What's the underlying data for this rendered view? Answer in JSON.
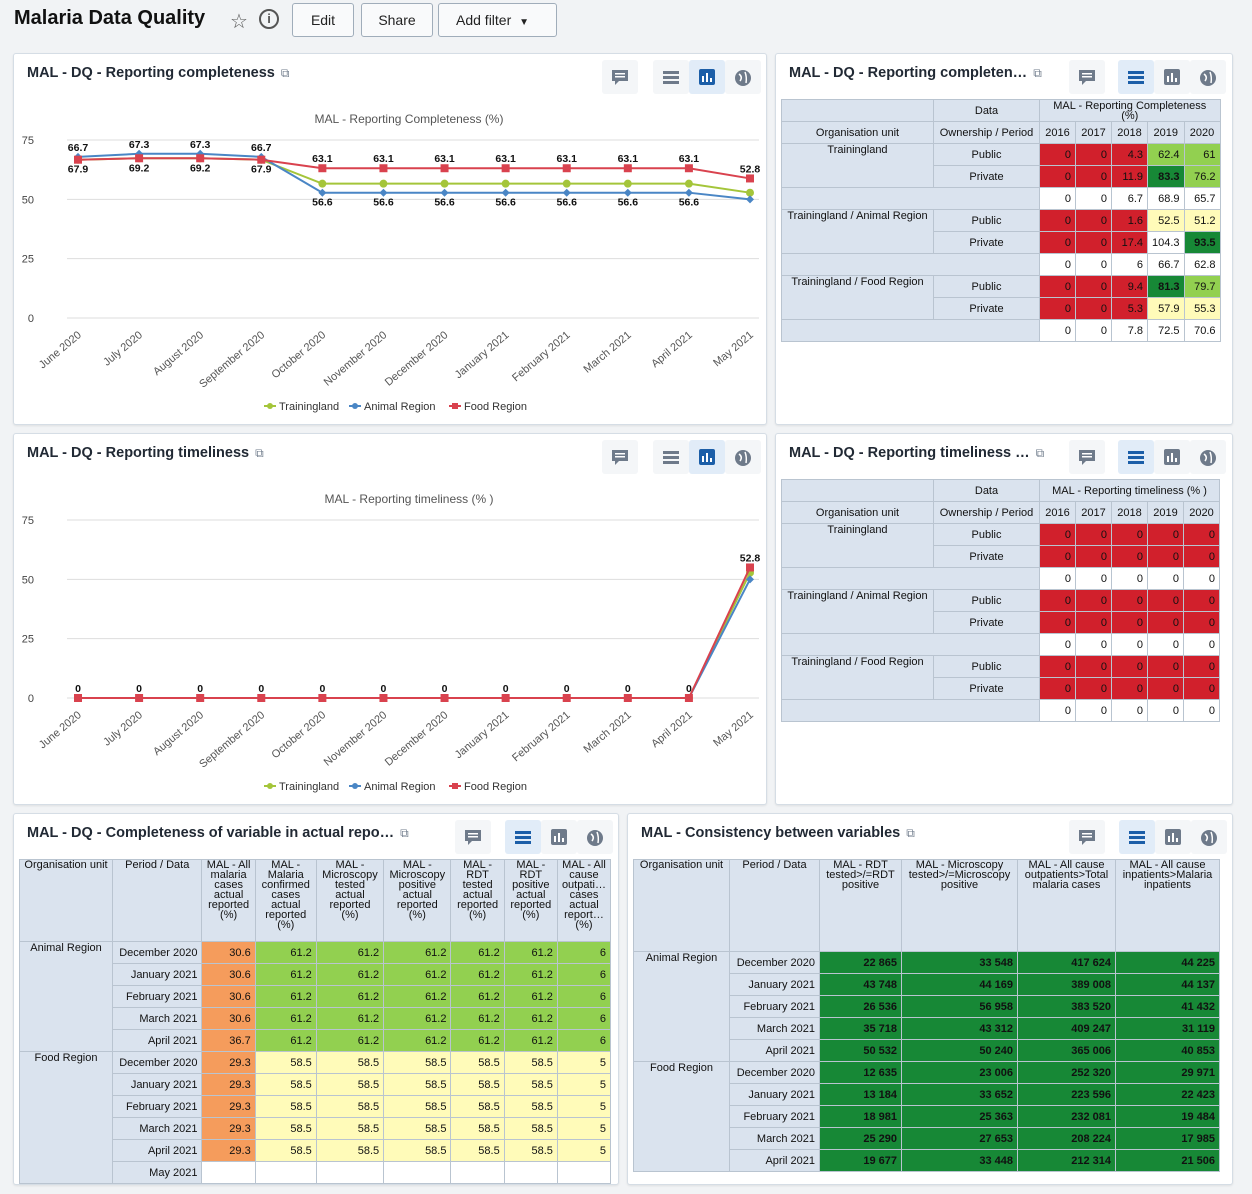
{
  "header": {
    "title": "Malaria Data Quality",
    "edit": "Edit",
    "share": "Share",
    "add_filter": "Add filter"
  },
  "icons": [
    "star-icon",
    "info-icon",
    "chevron-down-icon",
    "comment-icon",
    "table-icon",
    "chart-icon",
    "globe-icon",
    "external-link-icon"
  ],
  "cards": {
    "rep_completeness_chart": {
      "title": "MAL - DQ - Reporting completeness"
    },
    "rep_completeness_table": {
      "title": "MAL - DQ - Reporting completen…"
    },
    "rep_timeliness_chart": {
      "title": "MAL - DQ - Reporting timeliness"
    },
    "rep_timeliness_table": {
      "title": "MAL - DQ - Reporting timeliness …"
    },
    "var_completeness": {
      "title": "MAL - DQ - Completeness of variable in actual repo…"
    },
    "consistency": {
      "title": "MAL - Consistency between variables"
    }
  },
  "chart_data": [
    {
      "type": "line",
      "title": "MAL - Reporting Completeness (%)",
      "categories": [
        "June 2020",
        "July 2020",
        "August 2020",
        "September 2020",
        "October 2020",
        "November 2020",
        "December 2020",
        "January 2021",
        "February 2021",
        "March 2021",
        "April 2021",
        "May 2021"
      ],
      "yticks": [
        0,
        25,
        50,
        75
      ],
      "ylim": [
        0,
        75
      ],
      "legend_position": "bottom",
      "series": [
        {
          "name": "Trainingland",
          "color": "#a4c53a",
          "values": [
            66.7,
            67.3,
            67.3,
            66.7,
            56.6,
            56.6,
            56.6,
            56.6,
            56.6,
            56.6,
            56.6,
            52.8
          ]
        },
        {
          "name": "Animal Region",
          "color": "#4a86c5",
          "values": [
            67.9,
            69.2,
            69.2,
            67.9,
            52.8,
            52.8,
            52.8,
            52.8,
            52.8,
            52.8,
            52.8,
            50
          ]
        },
        {
          "name": "Food Region",
          "color": "#d9424e",
          "values": [
            66.7,
            67.3,
            67.3,
            66.7,
            63.1,
            63.1,
            63.1,
            63.1,
            63.1,
            63.1,
            63.1,
            58.8
          ]
        }
      ],
      "value_labels_top": [
        "66.7",
        "67.3",
        "67.3",
        "66.7",
        "63.1",
        "63.1",
        "63.1",
        "63.1",
        "63.1",
        "63.1",
        "63.1",
        "52.8"
      ],
      "value_labels_bottom": [
        "67.9",
        "69.2",
        "69.2",
        "67.9",
        "56.6",
        "56.6",
        "56.6",
        "56.6",
        "56.6",
        "56.6",
        "56.6",
        ""
      ]
    },
    {
      "type": "line",
      "title": "MAL - Reporting timeliness (% )",
      "categories": [
        "June 2020",
        "July 2020",
        "August 2020",
        "September 2020",
        "October 2020",
        "November 2020",
        "December 2020",
        "January 2021",
        "February 2021",
        "March 2021",
        "April 2021",
        "May 2021"
      ],
      "yticks": [
        0,
        25,
        50,
        75
      ],
      "ylim": [
        0,
        75
      ],
      "legend_position": "bottom",
      "series": [
        {
          "name": "Trainingland",
          "color": "#a4c53a",
          "values": [
            0,
            0,
            0,
            0,
            0,
            0,
            0,
            0,
            0,
            0,
            0,
            52.8
          ]
        },
        {
          "name": "Animal Region",
          "color": "#4a86c5",
          "values": [
            0,
            0,
            0,
            0,
            0,
            0,
            0,
            0,
            0,
            0,
            0,
            50
          ]
        },
        {
          "name": "Food Region",
          "color": "#d9424e",
          "values": [
            0,
            0,
            0,
            0,
            0,
            0,
            0,
            0,
            0,
            0,
            0,
            55
          ]
        }
      ],
      "value_labels_top": [
        "0",
        "0",
        "0",
        "0",
        "0",
        "0",
        "0",
        "0",
        "0",
        "0",
        "0",
        "52.8"
      ],
      "value_labels_bottom": [
        "",
        "",
        "",
        "",
        "",
        "",
        "",
        "",
        "",
        "",
        "",
        ""
      ]
    }
  ],
  "table_completeness": {
    "data_label": "Data",
    "metric": "MAL - Reporting Completeness (%)",
    "org_label": "Organisation unit",
    "own_label": "Ownership / Period",
    "years": [
      "2016",
      "2017",
      "2018",
      "2019",
      "2020"
    ],
    "rows": [
      {
        "org": "Trainingland",
        "own": "Public",
        "vals": [
          "0",
          "0",
          "4.3",
          "62.4",
          "61"
        ],
        "cls": [
          "red",
          "red",
          "red",
          "lgrn",
          "lgrn"
        ]
      },
      {
        "org": "",
        "own": "Private",
        "vals": [
          "0",
          "0",
          "11.9",
          "83.3",
          "76.2"
        ],
        "cls": [
          "red",
          "red",
          "red",
          "dgrn",
          "lgrn"
        ]
      },
      {
        "org": "",
        "own": "",
        "vals": [
          "0",
          "0",
          "6.7",
          "68.9",
          "65.7"
        ],
        "cls": [
          "num",
          "num",
          "num",
          "num",
          "num"
        ]
      },
      {
        "org": "Trainingland / Animal Region",
        "own": "Public",
        "vals": [
          "0",
          "0",
          "1.6",
          "52.5",
          "51.2"
        ],
        "cls": [
          "red",
          "red",
          "red",
          "yel",
          "yel"
        ]
      },
      {
        "org": "",
        "own": "Private",
        "vals": [
          "0",
          "0",
          "17.4",
          "104.3",
          "93.5"
        ],
        "cls": [
          "red",
          "red",
          "red",
          "num",
          "dgrn"
        ]
      },
      {
        "org": "",
        "own": "",
        "vals": [
          "0",
          "0",
          "6",
          "66.7",
          "62.8"
        ],
        "cls": [
          "num",
          "num",
          "num",
          "num",
          "num"
        ]
      },
      {
        "org": "Trainingland / Food Region",
        "own": "Public",
        "vals": [
          "0",
          "0",
          "9.4",
          "81.3",
          "79.7"
        ],
        "cls": [
          "red",
          "red",
          "red",
          "dgrn",
          "lgrn"
        ]
      },
      {
        "org": "",
        "own": "Private",
        "vals": [
          "0",
          "0",
          "5.3",
          "57.9",
          "55.3"
        ],
        "cls": [
          "red",
          "red",
          "red",
          "yel",
          "yel"
        ]
      },
      {
        "org": "",
        "own": "",
        "vals": [
          "0",
          "0",
          "7.8",
          "72.5",
          "70.6"
        ],
        "cls": [
          "num",
          "num",
          "num",
          "num",
          "num"
        ]
      }
    ]
  },
  "table_timeliness": {
    "data_label": "Data",
    "metric": "MAL - Reporting timeliness (% )",
    "org_label": "Organisation unit",
    "own_label": "Ownership / Period",
    "years": [
      "2016",
      "2017",
      "2018",
      "2019",
      "2020"
    ],
    "rows": [
      {
        "org": "Trainingland",
        "own": "Public",
        "vals": [
          "0",
          "0",
          "0",
          "0",
          "0"
        ],
        "cls": [
          "red",
          "red",
          "red",
          "red",
          "red"
        ]
      },
      {
        "org": "",
        "own": "Private",
        "vals": [
          "0",
          "0",
          "0",
          "0",
          "0"
        ],
        "cls": [
          "red",
          "red",
          "red",
          "red",
          "red"
        ]
      },
      {
        "org": "",
        "own": "",
        "vals": [
          "0",
          "0",
          "0",
          "0",
          "0"
        ],
        "cls": [
          "num",
          "num",
          "num",
          "num",
          "num"
        ]
      },
      {
        "org": "Trainingland / Animal Region",
        "own": "Public",
        "vals": [
          "0",
          "0",
          "0",
          "0",
          "0"
        ],
        "cls": [
          "red",
          "red",
          "red",
          "red",
          "red"
        ]
      },
      {
        "org": "",
        "own": "Private",
        "vals": [
          "0",
          "0",
          "0",
          "0",
          "0"
        ],
        "cls": [
          "red",
          "red",
          "red",
          "red",
          "red"
        ]
      },
      {
        "org": "",
        "own": "",
        "vals": [
          "0",
          "0",
          "0",
          "0",
          "0"
        ],
        "cls": [
          "num",
          "num",
          "num",
          "num",
          "num"
        ]
      },
      {
        "org": "Trainingland / Food Region",
        "own": "Public",
        "vals": [
          "0",
          "0",
          "0",
          "0",
          "0"
        ],
        "cls": [
          "red",
          "red",
          "red",
          "red",
          "red"
        ]
      },
      {
        "org": "",
        "own": "Private",
        "vals": [
          "0",
          "0",
          "0",
          "0",
          "0"
        ],
        "cls": [
          "red",
          "red",
          "red",
          "red",
          "red"
        ]
      },
      {
        "org": "",
        "own": "",
        "vals": [
          "0",
          "0",
          "0",
          "0",
          "0"
        ],
        "cls": [
          "num",
          "num",
          "num",
          "num",
          "num"
        ]
      }
    ]
  },
  "table_var": {
    "headers": [
      "Organisation unit",
      "Period / Data",
      "MAL - All malaria cases actual reported (%)",
      "MAL - Malaria confirmed cases actual reported (%)",
      "MAL - Microscopy tested actual reported (%)",
      "MAL - Microscopy positive actual reported (%)",
      "MAL - RDT tested actual reported (%)",
      "MAL - RDT positive actual reported (%)",
      "MAL - All cause outpati… cases actual report… (%)"
    ],
    "groups": [
      {
        "org": "Animal Region",
        "rows": [
          {
            "p": "December 2020",
            "v": [
              "30.6",
              "61.2",
              "61.2",
              "61.2",
              "61.2",
              "61.2",
              "6"
            ]
          },
          {
            "p": "January 2021",
            "v": [
              "30.6",
              "61.2",
              "61.2",
              "61.2",
              "61.2",
              "61.2",
              "6"
            ]
          },
          {
            "p": "February 2021",
            "v": [
              "30.6",
              "61.2",
              "61.2",
              "61.2",
              "61.2",
              "61.2",
              "6"
            ]
          },
          {
            "p": "March 2021",
            "v": [
              "30.6",
              "61.2",
              "61.2",
              "61.2",
              "61.2",
              "61.2",
              "6"
            ]
          },
          {
            "p": "April 2021",
            "v": [
              "36.7",
              "61.2",
              "61.2",
              "61.2",
              "61.2",
              "61.2",
              "6"
            ]
          }
        ]
      },
      {
        "org": "Food Region",
        "rows": [
          {
            "p": "December 2020",
            "v": [
              "29.3",
              "58.5",
              "58.5",
              "58.5",
              "58.5",
              "58.5",
              "5"
            ]
          },
          {
            "p": "January 2021",
            "v": [
              "29.3",
              "58.5",
              "58.5",
              "58.5",
              "58.5",
              "58.5",
              "5"
            ]
          },
          {
            "p": "February 2021",
            "v": [
              "29.3",
              "58.5",
              "58.5",
              "58.5",
              "58.5",
              "58.5",
              "5"
            ]
          },
          {
            "p": "March 2021",
            "v": [
              "29.3",
              "58.5",
              "58.5",
              "58.5",
              "58.5",
              "58.5",
              "5"
            ]
          },
          {
            "p": "April 2021",
            "v": [
              "29.3",
              "58.5",
              "58.5",
              "58.5",
              "58.5",
              "58.5",
              "5"
            ]
          },
          {
            "p": "May 2021",
            "v": [
              "",
              "",
              "",
              "",
              "",
              "",
              ""
            ]
          }
        ]
      }
    ]
  },
  "table_cons": {
    "headers": [
      "Organisation unit",
      "Period / Data",
      "MAL - RDT tested>/=RDT positive",
      "MAL - Microscopy tested>/=Microscopy positive",
      "MAL - All cause outpatients>Total malaria cases",
      "MAL - All cause inpatients>Malaria inpatients"
    ],
    "groups": [
      {
        "org": "Animal Region",
        "rows": [
          {
            "p": "December 2020",
            "v": [
              "22 865",
              "33 548",
              "417 624",
              "44 225"
            ]
          },
          {
            "p": "January 2021",
            "v": [
              "43 748",
              "44 169",
              "389 008",
              "44 137"
            ]
          },
          {
            "p": "February 2021",
            "v": [
              "26 536",
              "56 958",
              "383 520",
              "41 432"
            ]
          },
          {
            "p": "March 2021",
            "v": [
              "35 718",
              "43 312",
              "409 247",
              "31 119"
            ]
          },
          {
            "p": "April 2021",
            "v": [
              "50 532",
              "50 240",
              "365 006",
              "40 853"
            ]
          }
        ]
      },
      {
        "org": "Food Region",
        "rows": [
          {
            "p": "December 2020",
            "v": [
              "12 635",
              "23 006",
              "252 320",
              "29 971"
            ]
          },
          {
            "p": "January 2021",
            "v": [
              "13 184",
              "33 652",
              "223 596",
              "22 423"
            ]
          },
          {
            "p": "February 2021",
            "v": [
              "18 981",
              "25 363",
              "232 081",
              "19 484"
            ]
          },
          {
            "p": "March 2021",
            "v": [
              "25 290",
              "27 653",
              "208 224",
              "17 985"
            ]
          },
          {
            "p": "April 2021",
            "v": [
              "19 677",
              "33 448",
              "212 314",
              "21 506"
            ]
          }
        ]
      }
    ]
  }
}
